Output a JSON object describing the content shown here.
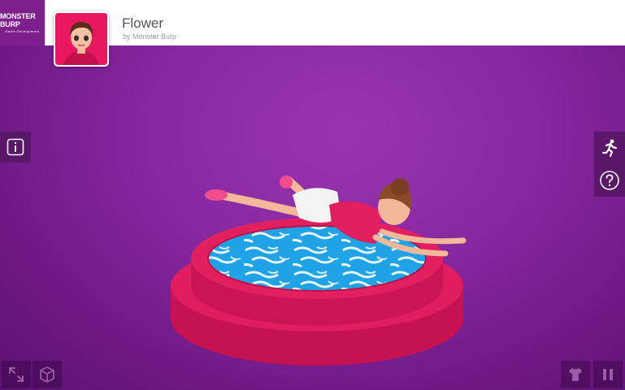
{
  "brand": {
    "name": "MONSTER BURP",
    "tagline": "Game Development"
  },
  "model": {
    "title": "Flower",
    "author": "by Monster Burp"
  },
  "colors": {
    "accent": "#7e1f8d",
    "background": "#8a2aa3",
    "pool_rim": "#d8185a",
    "water": "#1aa6e8"
  },
  "controls": {
    "info": "info-icon",
    "animation": "running-icon",
    "help": "question-icon",
    "fullscreen": "expand-icon",
    "vr": "cube-icon",
    "outfit": "shirt-icon",
    "pause": "pause-icon"
  }
}
